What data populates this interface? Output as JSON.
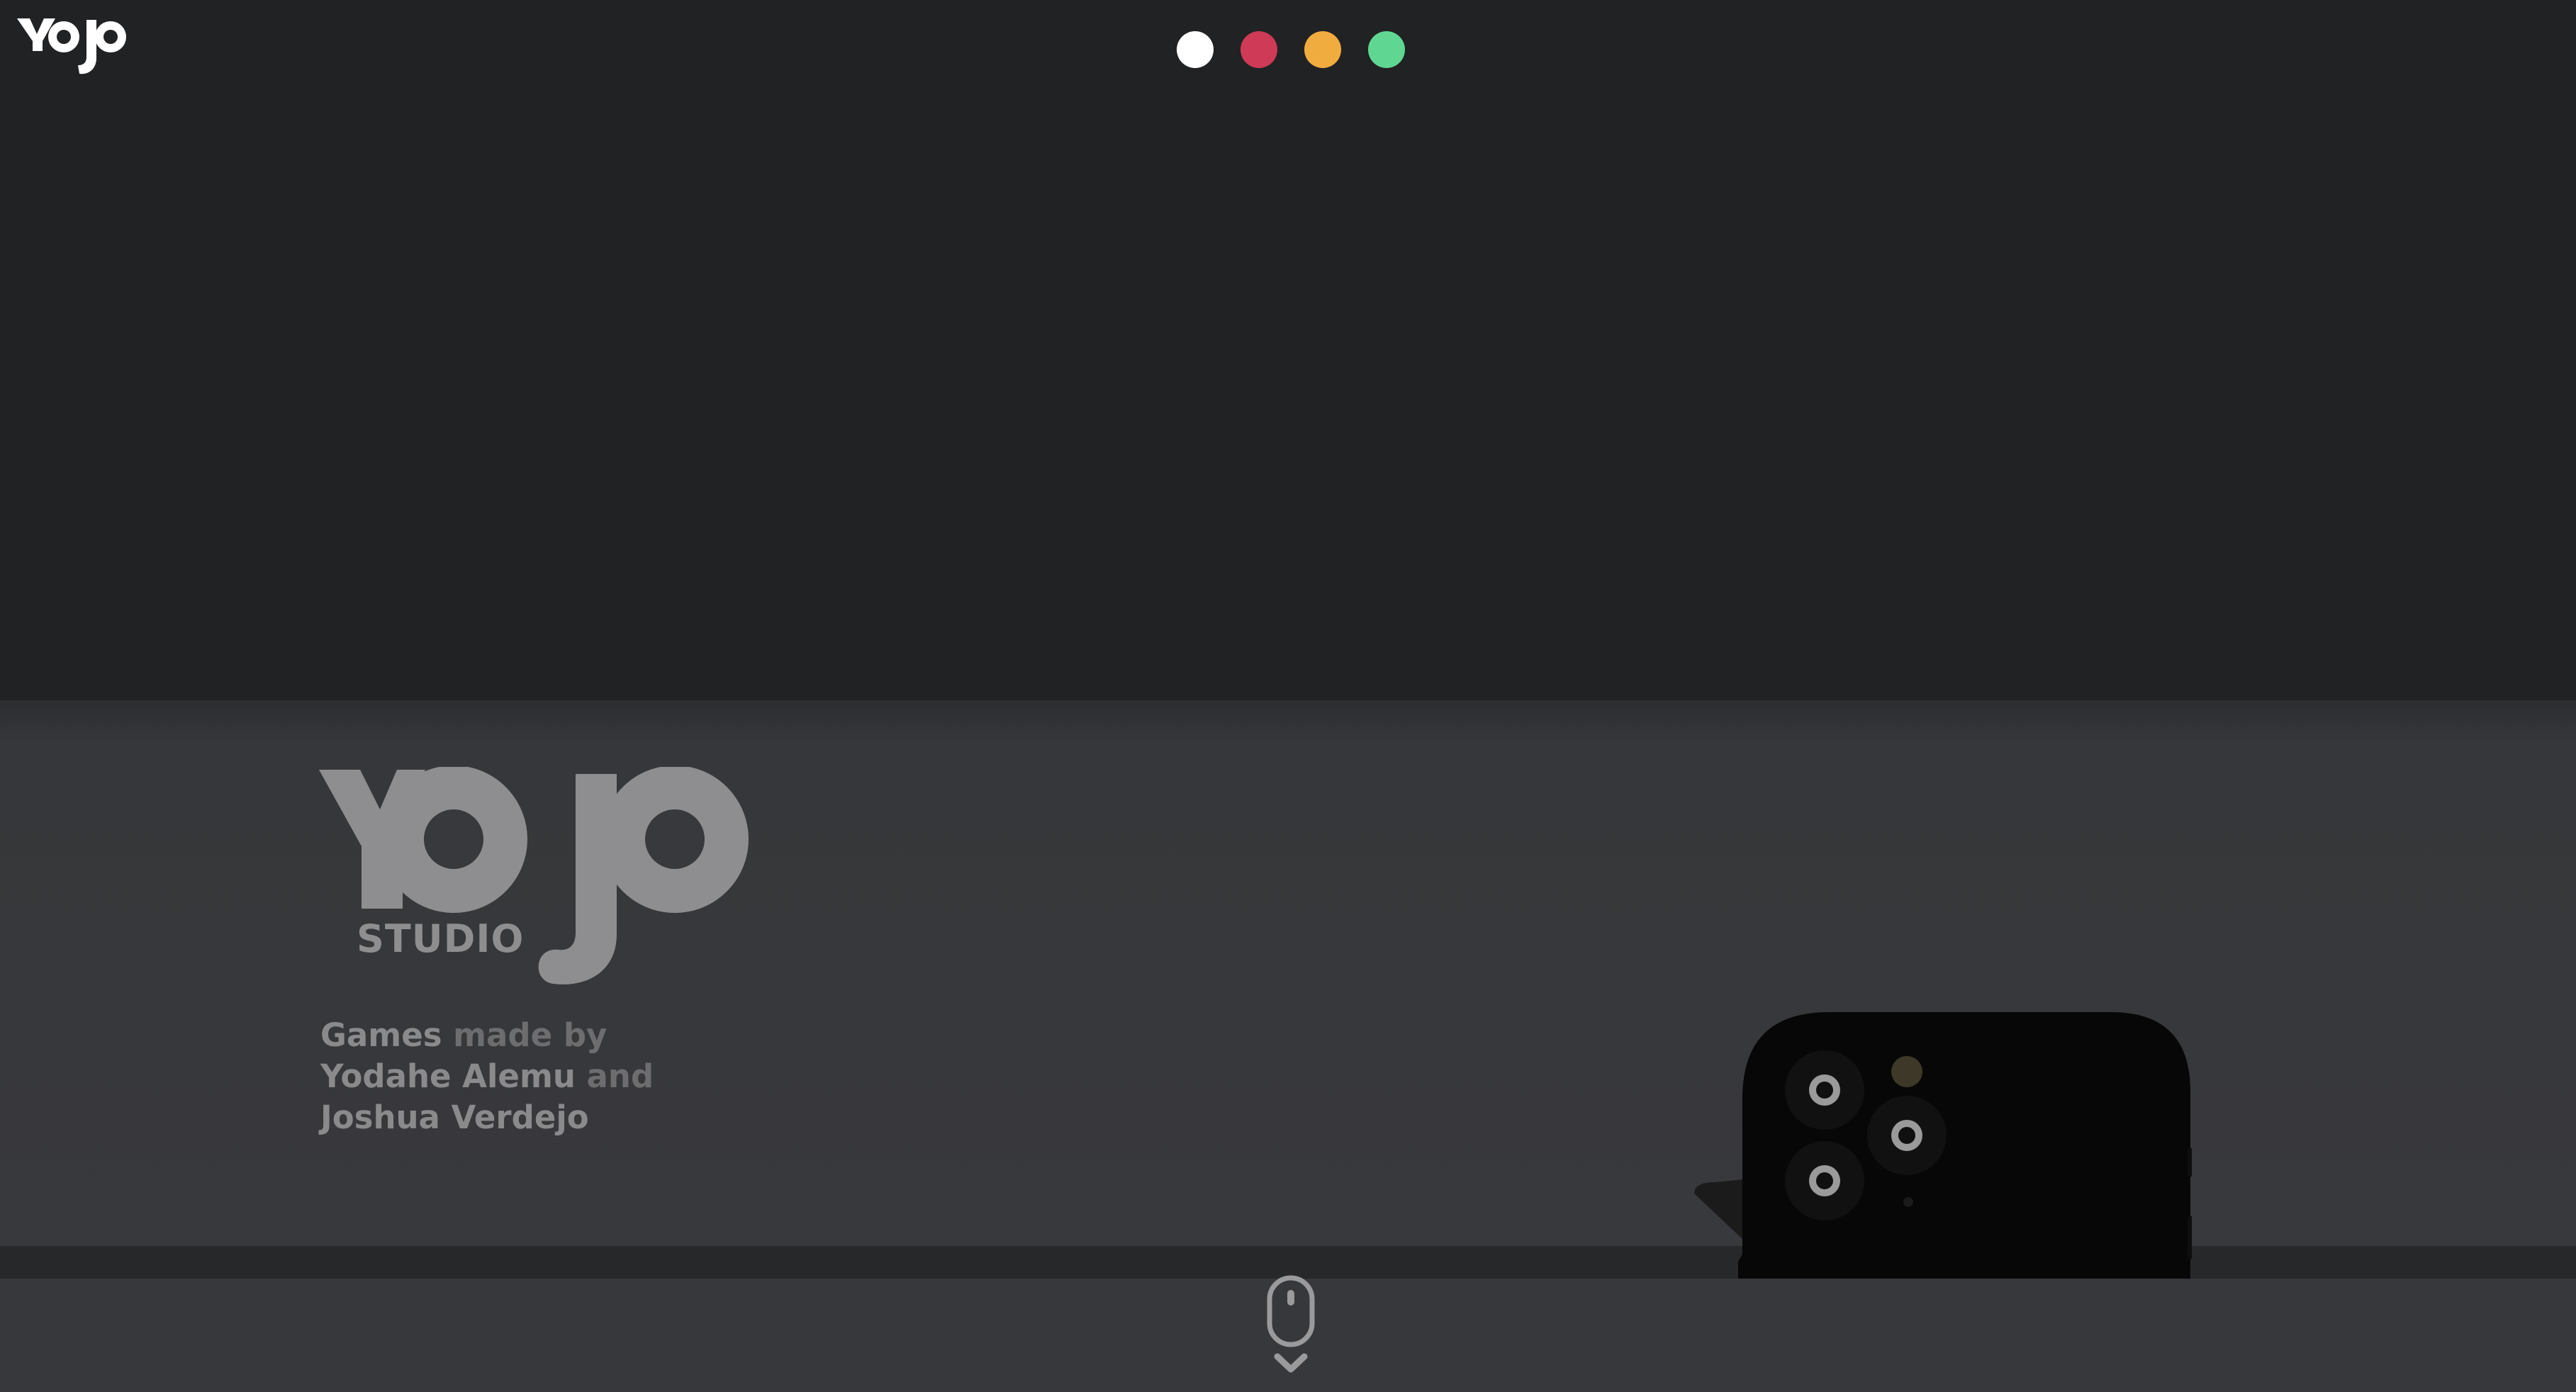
{
  "header": {
    "logo_icon": "yojo-logo-icon",
    "theme_dots": [
      {
        "name": "theme-dot-white",
        "color": "#ffffff"
      },
      {
        "name": "theme-dot-red",
        "color": "#cf3a56"
      },
      {
        "name": "theme-dot-orange",
        "color": "#f1ac3f"
      },
      {
        "name": "theme-dot-green",
        "color": "#5fd793"
      }
    ]
  },
  "hero": {
    "logo_text": "YOJO",
    "studio_label": "STUDIO",
    "tagline": {
      "line1_strong": "Games",
      "line1_muted": " made by",
      "line2_strong": "Yodahe Alemu",
      "line2_muted": " and",
      "line3_strong": "Joshua Verdejo"
    },
    "device_icon": "phone-camera-icon"
  },
  "footer": {
    "scroll_icon": "mouse-scroll-icon"
  },
  "colors": {
    "background": "#212224",
    "panel": "#38393c",
    "logo_gray": "#8e8e91",
    "text_muted": "#6d6d70"
  }
}
